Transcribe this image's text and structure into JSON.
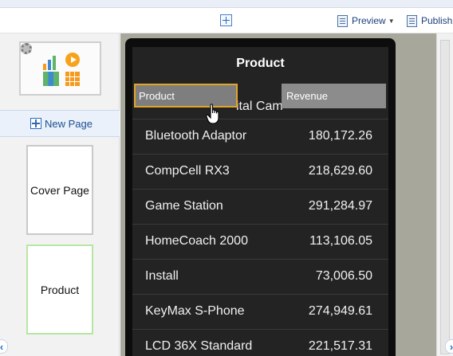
{
  "toolbar": {
    "preview_label": "Preview",
    "publish_label": "Publish"
  },
  "left_panel": {
    "new_page_label": "New Page",
    "pages": [
      {
        "label": "Cover Page"
      },
      {
        "label": "Product"
      }
    ]
  },
  "canvas": {
    "list_title": "Product",
    "partial_row_label": "ital Cam",
    "rows": [
      {
        "name": "Bluetooth Adaptor",
        "value": "180,172.26"
      },
      {
        "name": "CompCell RX3",
        "value": "218,629.60"
      },
      {
        "name": "Game Station",
        "value": "291,284.97"
      },
      {
        "name": "HomeCoach 2000",
        "value": "113,106.05"
      },
      {
        "name": "Install",
        "value": "73,006.50"
      },
      {
        "name": "KeyMax S-Phone",
        "value": "274,949.61"
      },
      {
        "name": "LCD 36X Standard",
        "value": "221,517.31"
      }
    ],
    "drag_fields": {
      "product": "Product",
      "revenue": "Revenue"
    }
  },
  "icons": {
    "add": "plus-icon",
    "preview": "preview-icon",
    "publish": "publish-icon",
    "settings": "gear-icon",
    "nav_left": "chevron-left-icon",
    "nav_right": "chevron-right-icon"
  }
}
